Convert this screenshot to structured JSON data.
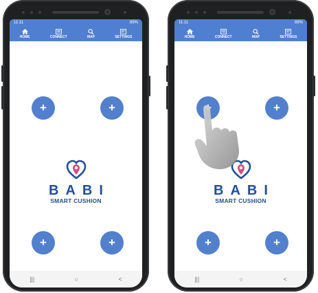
{
  "status_bar": {
    "time": "11:11",
    "right": "89%"
  },
  "nav": [
    {
      "label": "HOME",
      "icon": "home-icon"
    },
    {
      "label": "CONNECT",
      "icon": "connect-icon"
    },
    {
      "label": "MAP",
      "icon": "search-icon"
    },
    {
      "label": "SETTINGS",
      "icon": "settings-icon"
    }
  ],
  "plus_symbol": "+",
  "brand": {
    "name": "BABI",
    "tagline": "SMART CUSHION"
  },
  "system_nav": {
    "recents": "|||",
    "home": "○",
    "back": "<"
  },
  "colors": {
    "accent": "#4f7fd0",
    "button": "#5280cc",
    "brand": "#1f4f9a"
  }
}
